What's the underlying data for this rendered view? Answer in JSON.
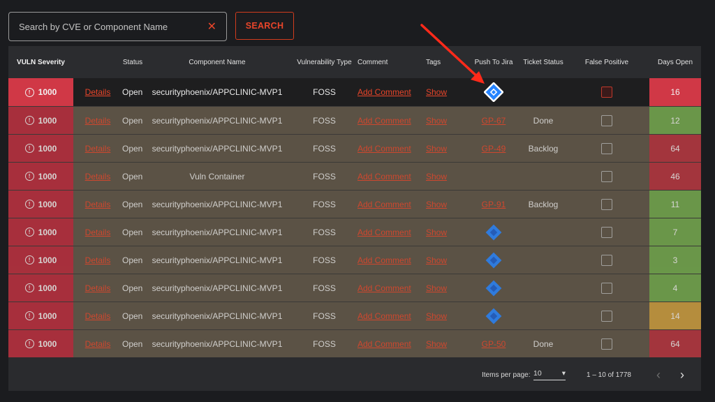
{
  "search": {
    "placeholder": "Search by CVE or Component Name",
    "clear_icon": "close-icon",
    "button_label": "SEARCH"
  },
  "table": {
    "headers": [
      "VULN Severity",
      "",
      "Status",
      "Component Name",
      "Vulnerability Type",
      "Comment",
      "Tags",
      "Push To Jira",
      "Ticket Status",
      "False Positive",
      "Days Open"
    ],
    "rows": [
      {
        "severity": "1000",
        "details": "Details",
        "status": "Open",
        "component": "securityphoenix/APPCLINIC-MVP1",
        "type": "FOSS",
        "comment": "Add Comment",
        "tags": "Show",
        "jira": "",
        "jira_kind": "icon-highlight",
        "ticket": "",
        "days": "16",
        "days_color": "red"
      },
      {
        "severity": "1000",
        "details": "Details",
        "status": "Open",
        "component": "securityphoenix/APPCLINIC-MVP1",
        "type": "FOSS",
        "comment": "Add Comment",
        "tags": "Show",
        "jira": "GP-67",
        "jira_kind": "link",
        "ticket": "Done",
        "days": "12",
        "days_color": "green"
      },
      {
        "severity": "1000",
        "details": "Details",
        "status": "Open",
        "component": "securityphoenix/APPCLINIC-MVP1",
        "type": "FOSS",
        "comment": "Add Comment",
        "tags": "Show",
        "jira": "GP-49",
        "jira_kind": "link",
        "ticket": "Backlog",
        "days": "64",
        "days_color": "red"
      },
      {
        "severity": "1000",
        "details": "Details",
        "status": "Open",
        "component": "Vuln Container",
        "type": "FOSS",
        "comment": "Add Comment",
        "tags": "Show",
        "jira": "",
        "jira_kind": "none",
        "ticket": "",
        "days": "46",
        "days_color": "red"
      },
      {
        "severity": "1000",
        "details": "Details",
        "status": "Open",
        "component": "securityphoenix/APPCLINIC-MVP1",
        "type": "FOSS",
        "comment": "Add Comment",
        "tags": "Show",
        "jira": "GP-91",
        "jira_kind": "link",
        "ticket": "Backlog",
        "days": "11",
        "days_color": "green"
      },
      {
        "severity": "1000",
        "details": "Details",
        "status": "Open",
        "component": "securityphoenix/APPCLINIC-MVP1",
        "type": "FOSS",
        "comment": "Add Comment",
        "tags": "Show",
        "jira": "",
        "jira_kind": "icon",
        "ticket": "",
        "days": "7",
        "days_color": "green"
      },
      {
        "severity": "1000",
        "details": "Details",
        "status": "Open",
        "component": "securityphoenix/APPCLINIC-MVP1",
        "type": "FOSS",
        "comment": "Add Comment",
        "tags": "Show",
        "jira": "",
        "jira_kind": "icon",
        "ticket": "",
        "days": "3",
        "days_color": "green"
      },
      {
        "severity": "1000",
        "details": "Details",
        "status": "Open",
        "component": "securityphoenix/APPCLINIC-MVP1",
        "type": "FOSS",
        "comment": "Add Comment",
        "tags": "Show",
        "jira": "",
        "jira_kind": "icon",
        "ticket": "",
        "days": "4",
        "days_color": "green"
      },
      {
        "severity": "1000",
        "details": "Details",
        "status": "Open",
        "component": "securityphoenix/APPCLINIC-MVP1",
        "type": "FOSS",
        "comment": "Add Comment",
        "tags": "Show",
        "jira": "",
        "jira_kind": "icon",
        "ticket": "",
        "days": "14",
        "days_color": "amber"
      },
      {
        "severity": "1000",
        "details": "Details",
        "status": "Open",
        "component": "securityphoenix/APPCLINIC-MVP1",
        "type": "FOSS",
        "comment": "Add Comment",
        "tags": "Show",
        "jira": "GP-50",
        "jira_kind": "link",
        "ticket": "Done",
        "days": "64",
        "days_color": "red"
      }
    ]
  },
  "footer": {
    "items_label": "Items per page:",
    "items_value": "10",
    "range": "1 – 10 of 1778",
    "prev_icon": "chevron-left-icon",
    "next_icon": "chevron-right-icon"
  },
  "colors": {
    "accent": "#e8452a",
    "severity": "#b8283b",
    "days_red": "#b32f3c",
    "days_green": "#6ea64b",
    "days_amber": "#c99a3c",
    "jira_blue": "#2684ff"
  },
  "annotation": {
    "arrow_color": "#ff2a1a",
    "arrow_icon": "red-arrow-icon"
  }
}
